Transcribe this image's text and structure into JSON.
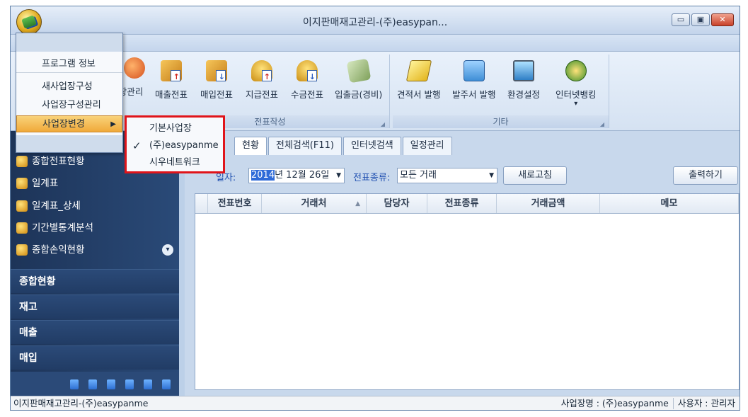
{
  "window": {
    "title": "이지판매재고관리-(주)easypan...",
    "min": "▭",
    "max": "▣",
    "close": "✕"
  },
  "ribbon": {
    "partial_label": "장관리",
    "buttons": [
      {
        "label": "매출전표",
        "icon": "document-up-icon"
      },
      {
        "label": "매입전표",
        "icon": "document-down-icon"
      },
      {
        "label": "지급전표",
        "icon": "coin-up-icon"
      },
      {
        "label": "수금전표",
        "icon": "coin-down-icon"
      },
      {
        "label": "입출금(경비)",
        "icon": "money-icon"
      },
      {
        "label": "견적서 발행",
        "icon": "estimate-icon"
      },
      {
        "label": "발주서 발행",
        "icon": "order-icon"
      },
      {
        "label": "환경설정",
        "icon": "settings-monitor-icon"
      },
      {
        "label": "인터넷뱅킹",
        "icon": "bank-icon",
        "dropdown": "▾"
      }
    ],
    "groups": [
      {
        "label": "전표작성",
        "corner": "◢"
      },
      {
        "label": "기타",
        "corner": "◢"
      }
    ]
  },
  "app_menu": {
    "items": [
      "프로그램 정보",
      "새사업장구성",
      "사업장구성관리",
      "사업장변경"
    ],
    "submenu_arrow": "▶"
  },
  "submenu": {
    "items": [
      "기본사업장",
      "(주)easypanme",
      "시우네트워크"
    ],
    "checked_index": 1,
    "check": "✓"
  },
  "left_nav": {
    "items": [
      "종합전표현황",
      "일계표",
      "일계표_상세",
      "기간별통계분석",
      "종합손익현황"
    ],
    "more": "▾",
    "sections": [
      "종합현황",
      "재고",
      "매출",
      "매입"
    ]
  },
  "tabs": {
    "partial": "현황",
    "items": [
      "전체검색(F11)",
      "인터넷검색",
      "일정관리"
    ]
  },
  "filters": {
    "date_label_partial": "일자:",
    "date_year": "2014",
    "date_rest": "년 12월 26일",
    "type_label": "전표종류:",
    "type_value": "모든 거래",
    "arrow": "▼",
    "refresh": "새로고침",
    "print": "출력하기"
  },
  "grid": {
    "columns": [
      "전표번호",
      "거래처",
      "담당자",
      "전표종류",
      "거래금액",
      "메모"
    ],
    "sort_indicator": "▲"
  },
  "status": {
    "left": "이지판매재고관리-(주)easypanme",
    "business": "사업장명 : (주)easypanme",
    "user": "사용자 : 관리자"
  },
  "colors": {
    "highlight_border": "#e0141a",
    "menu_highlight": "#f0a93a",
    "nav_background": "#1d3458"
  }
}
